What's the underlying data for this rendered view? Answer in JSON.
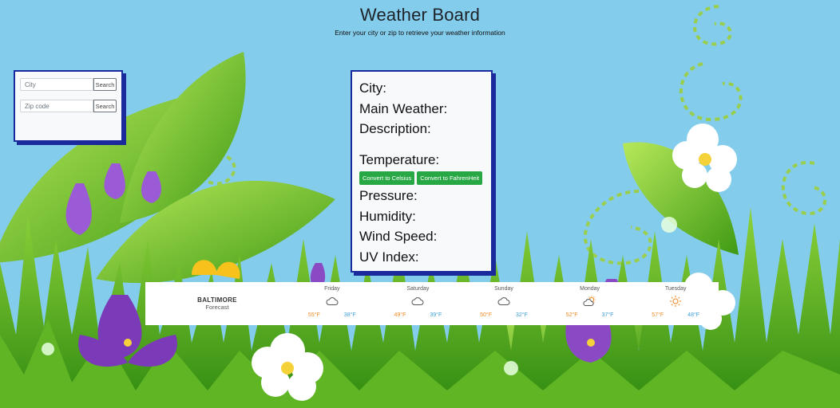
{
  "header": {
    "title": "Weather Board",
    "subtitle": "Enter your city or zip to retrieve your weather information"
  },
  "search": {
    "city_placeholder": "City",
    "city_button": "Search",
    "zip_placeholder": "Zip code",
    "zip_button": "Search"
  },
  "weather": {
    "city_label": "City:",
    "main_label": "Main Weather:",
    "description_label": "Description:",
    "temperature_label": "Temperature:",
    "celsius_button": "Convert to Celsius",
    "fahrenheit_button": "Convert to FahrenHeit",
    "pressure_label": "Pressure:",
    "humidity_label": "Humidity:",
    "wind_label": "Wind Speed:",
    "uv_label": "UV Index:"
  },
  "forecast": {
    "city": "BALTIMORE",
    "label": "Forecast",
    "days": [
      {
        "name": "Friday",
        "icon": "cloud-icon",
        "high": "55°F",
        "low": "38°F"
      },
      {
        "name": "Saturday",
        "icon": "cloud-icon",
        "high": "49°F",
        "low": "39°F"
      },
      {
        "name": "Sunday",
        "icon": "cloud-icon",
        "high": "50°F",
        "low": "32°F"
      },
      {
        "name": "Monday",
        "icon": "partly-sunny-icon",
        "high": "52°F",
        "low": "37°F"
      },
      {
        "name": "Tuesday",
        "icon": "sun-icon",
        "high": "57°F",
        "low": "48°F"
      }
    ]
  },
  "colors": {
    "sky": "#84cceb",
    "panel_border": "#1a2a9c",
    "button_green": "#28a745",
    "high_temp": "#f08a24",
    "low_temp": "#3b9dd8"
  }
}
